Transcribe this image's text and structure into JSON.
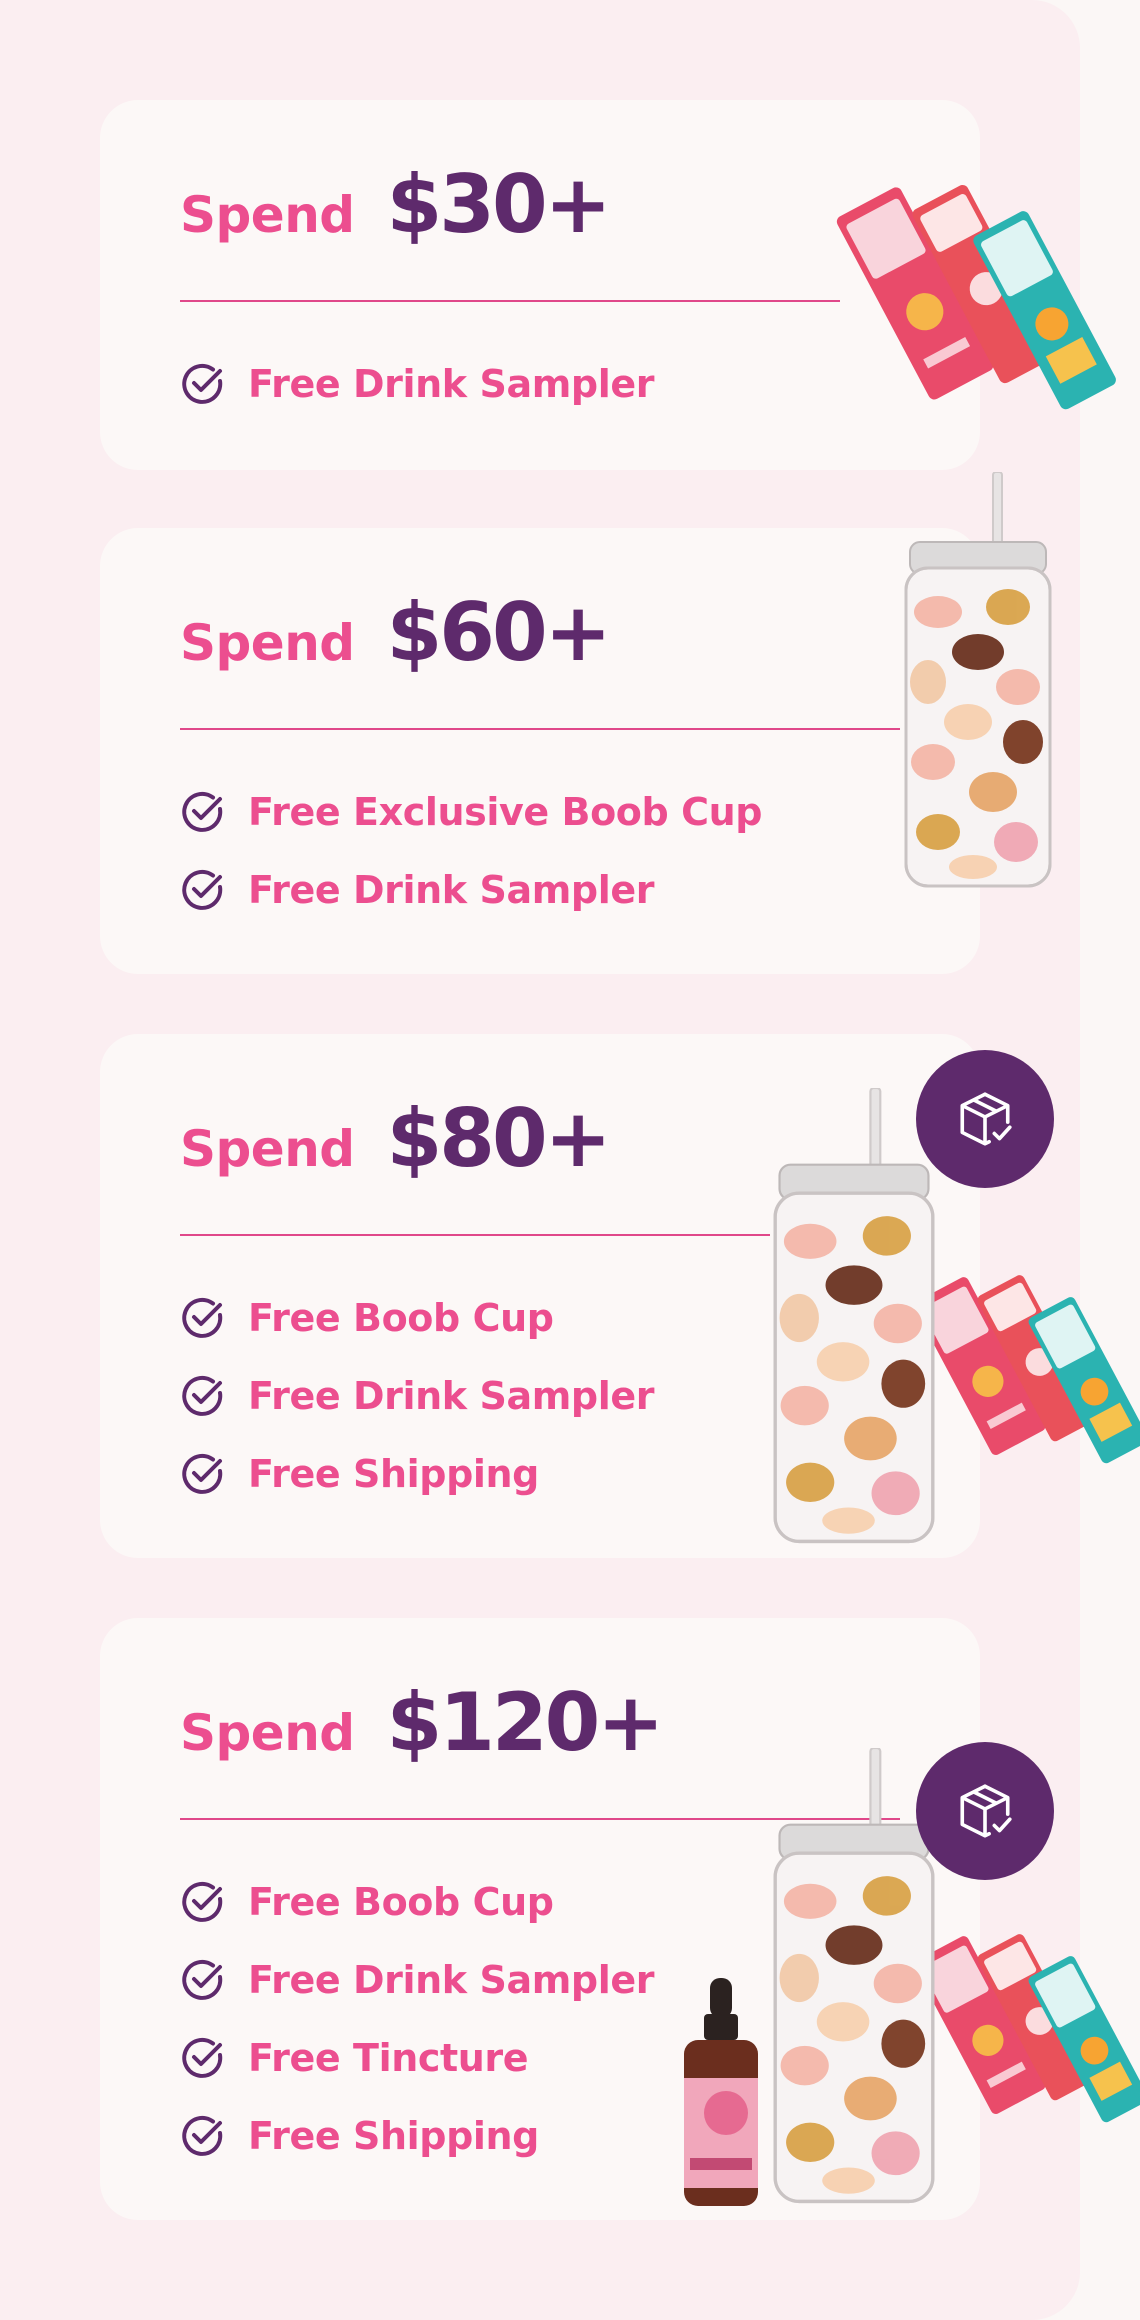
{
  "tiers": [
    {
      "spend_word": "Spend",
      "amount": "$30+",
      "perks": [
        "Free Drink Sampler"
      ],
      "icons": [
        "drink-sampler-packs-image"
      ]
    },
    {
      "spend_word": "Spend",
      "amount": "$60+",
      "perks": [
        "Free Exclusive Boob Cup",
        "Free Drink Sampler"
      ],
      "icons": [
        "boob-cup-image"
      ]
    },
    {
      "spend_word": "Spend",
      "amount": "$80+",
      "perks": [
        "Free Boob Cup",
        "Free Drink Sampler",
        "Free Shipping"
      ],
      "icons": [
        "free-shipping-box-icon",
        "boob-cup-image",
        "drink-sampler-packs-image"
      ]
    },
    {
      "spend_word": "Spend",
      "amount": "$120+",
      "perks": [
        "Free Boob Cup",
        "Free Drink Sampler",
        "Free Tincture",
        "Free Shipping"
      ],
      "icons": [
        "free-shipping-box-icon",
        "boob-cup-image",
        "drink-sampler-packs-image",
        "tincture-bottle-image"
      ]
    }
  ],
  "colors": {
    "panel_bg": "#fbeef1",
    "card_bg": "#fcf8f7",
    "spend_pink": "#ec4e8f",
    "amount_purple": "#5e2a6c",
    "divider": "#e0488a",
    "check_purple": "#5e2a6c"
  }
}
